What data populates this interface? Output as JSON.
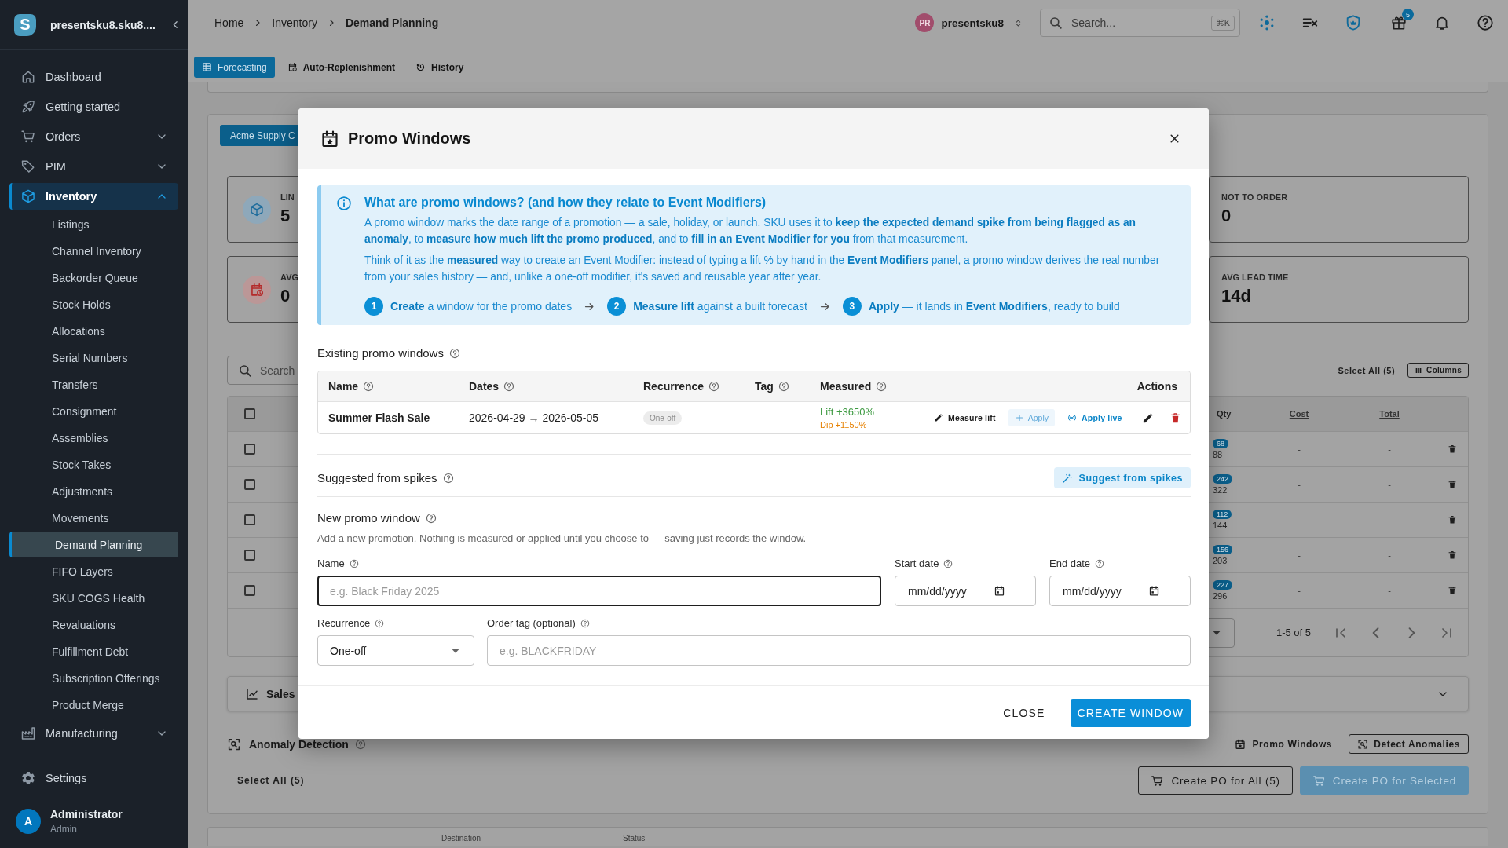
{
  "sidebar": {
    "logo": "S",
    "workspace": "presentsku8.sku8....",
    "items": [
      {
        "label": "Dashboard",
        "selected": false
      },
      {
        "label": "Getting started",
        "selected": false
      },
      {
        "label": "Orders",
        "selected": false,
        "expanded": false
      },
      {
        "label": "PIM",
        "selected": false,
        "expanded": false
      },
      {
        "label": "Inventory",
        "selected": true,
        "expanded": true,
        "children": [
          {
            "label": "Listings",
            "selected": false
          },
          {
            "label": "Channel Inventory",
            "selected": false
          },
          {
            "label": "Backorder Queue",
            "selected": false
          },
          {
            "label": "Stock Holds",
            "selected": false
          },
          {
            "label": "Allocations",
            "selected": false
          },
          {
            "label": "Serial Numbers",
            "selected": false
          },
          {
            "label": "Transfers",
            "selected": false
          },
          {
            "label": "Consignment",
            "selected": false
          },
          {
            "label": "Assemblies",
            "selected": false
          },
          {
            "label": "Stock Takes",
            "selected": false
          },
          {
            "label": "Adjustments",
            "selected": false
          },
          {
            "label": "Movements",
            "selected": false
          },
          {
            "label": "Demand Planning",
            "selected": true
          },
          {
            "label": "FIFO Layers",
            "selected": false
          },
          {
            "label": "SKU COGS Health",
            "selected": false
          },
          {
            "label": "Revaluations",
            "selected": false
          },
          {
            "label": "Fulfillment Debt",
            "selected": false
          },
          {
            "label": "Subscription Offerings",
            "selected": false
          },
          {
            "label": "Product Merge",
            "selected": false
          }
        ]
      },
      {
        "label": "Manufacturing",
        "selected": false,
        "expanded": false
      }
    ],
    "bottom_items": [
      {
        "label": "Settings",
        "selected": false
      }
    ],
    "user": {
      "initial": "A",
      "name": "Administrator",
      "role": "Admin"
    }
  },
  "top_bar": {
    "breadcrumbs": [
      "Home",
      "Inventory",
      "Demand Planning"
    ],
    "account": {
      "initials": "PR",
      "name": "presentsku8"
    },
    "search": {
      "placeholder": "Search...",
      "shortcut": "⌘K"
    },
    "gift_badge": "5"
  },
  "tabs": [
    {
      "label": "Forecasting",
      "selected": true
    },
    {
      "label": "Auto-Replenishment",
      "selected": false
    },
    {
      "label": "History",
      "selected": false
    }
  ],
  "page": {
    "supplier_button": "Acme Supply C",
    "stat_rows": [
      [
        {
          "label": "LIN",
          "value": "5"
        },
        {
          "label": "NOT TO ORDER",
          "value": "0"
        }
      ],
      [
        {
          "label": "AVG",
          "value": "0"
        },
        {
          "label": "AVG LEAD TIME",
          "value": "14d"
        }
      ]
    ],
    "table": {
      "search_placeholder": "Search",
      "select_all": "Select All (5)",
      "columns_button": "Columns",
      "header_checked": false,
      "columns": [
        "Qty",
        "Cost",
        "Total"
      ],
      "rows": [
        {
          "checked": false,
          "qty": "68",
          "qty_note": "88",
          "cost": "-",
          "total": "-"
        },
        {
          "checked": false,
          "qty": "242",
          "qty_note": "322",
          "cost": "-",
          "total": "-"
        },
        {
          "checked": false,
          "qty": "112",
          "qty_note": "144",
          "cost": "-",
          "total": "-"
        },
        {
          "checked": false,
          "qty": "156",
          "qty_note": "203",
          "cost": "-",
          "total": "-"
        },
        {
          "checked": false,
          "qty": "227",
          "qty_note": "296",
          "cost": "-",
          "total": "-"
        }
      ],
      "pagination": "1-5 of 5"
    },
    "sales_panel": {
      "title": "Sales",
      "expanded": false
    },
    "anomaly_section": {
      "title": "Anomaly Detection",
      "promo_button": "Promo Windows",
      "detect_button": "Detect Anomalies"
    },
    "footer": {
      "select_all": "Select All (5)",
      "create_all": "Create PO for All (5)",
      "create_selected": {
        "label": "Create PO for Selected",
        "disabled": true
      }
    },
    "next_table_columns": [
      "Destination",
      "Status"
    ]
  },
  "modal": {
    "title": "Promo Windows",
    "info": {
      "title": "What are promo windows? (and how they relate to Event Modifiers)",
      "paragraphs": [
        "A promo window marks the date range of a promotion — a sale, holiday, or launch. SKU uses it to **keep the expected demand spike from being flagged as an anomaly**, to **measure how much lift the promo produced**, and to **fill in an Event Modifier for you** from that measurement.",
        "Think of it as the **measured** way to create an Event Modifier: instead of typing a lift % by hand in the **Event Modifiers** panel, a promo window derives the real number from your sales history — and, unlike a one-off modifier, it's saved and reusable year after year."
      ],
      "steps": [
        {
          "number": "1",
          "text": "**Create** a window for the promo dates"
        },
        {
          "number": "2",
          "text": "**Measure lift** against a built forecast"
        },
        {
          "number": "3",
          "text": "**Apply** — it lands in **Event Modifiers**, ready to build"
        }
      ]
    },
    "existing": {
      "title": "Existing promo windows",
      "columns": [
        {
          "label": "Name",
          "help": true
        },
        {
          "label": "Dates",
          "help": true
        },
        {
          "label": "Recurrence",
          "help": true
        },
        {
          "label": "Tag",
          "help": true
        },
        {
          "label": "Measured",
          "help": true
        },
        {
          "label": "Actions",
          "help": false
        }
      ],
      "rows": [
        {
          "name": "Summer Flash Sale",
          "dates": "2026-04-29 → 2026-05-05",
          "recurrence": "One-off",
          "tag": "—",
          "lift": "Lift +3650%",
          "dip": "Dip +1150%",
          "actions": [
            {
              "kind": "measure",
              "label": "Measure lift",
              "disabled": false
            },
            {
              "kind": "apply",
              "label": "Apply",
              "disabled": true
            },
            {
              "kind": "apply_live",
              "label": "Apply live",
              "disabled": false
            },
            {
              "kind": "edit",
              "disabled": false
            },
            {
              "kind": "delete",
              "disabled": false
            }
          ]
        }
      ]
    },
    "suggested": {
      "title": "Suggested from spikes",
      "button": "Suggest from spikes"
    },
    "new_window": {
      "title": "New promo window",
      "description": "Add a new promotion. Nothing is measured or applied until you choose to — saving just records the window.",
      "field_rows": [
        [
          {
            "kind": "text",
            "label": "Name",
            "placeholder": "e.g. Black Friday 2025",
            "focused": true
          },
          {
            "kind": "date",
            "label": "Start date",
            "placeholder": "mm/dd/yyyy"
          },
          {
            "kind": "date",
            "label": "End date",
            "placeholder": "mm/dd/yyyy"
          }
        ],
        [
          {
            "kind": "select",
            "label": "Recurrence",
            "value": "One-off"
          },
          {
            "kind": "text",
            "label": "Order tag (optional)",
            "placeholder": "e.g. BLACKFRIDAY",
            "focused": false
          }
        ]
      ]
    },
    "close_button": "CLOSE",
    "create_button": "CREATE WINDOW"
  }
}
